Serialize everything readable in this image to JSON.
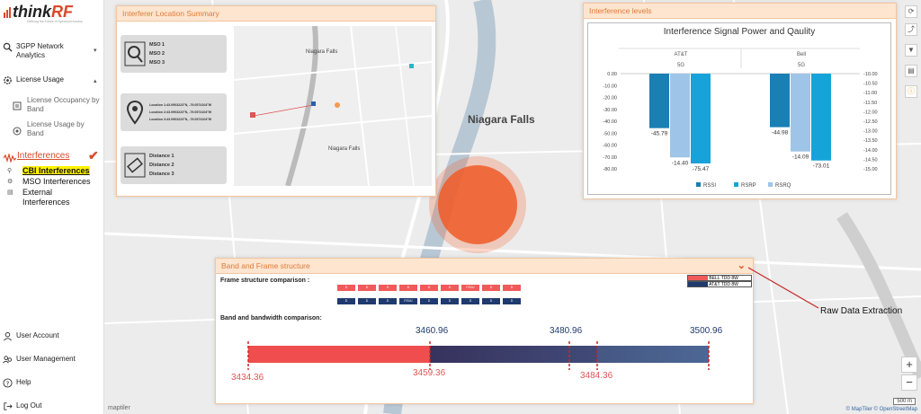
{
  "app": {
    "logo_text": "think",
    "logo_accent": "RF",
    "logo_tagline": "Defining the Future of Spectrum Access"
  },
  "sidebar": {
    "items": [
      {
        "id": "3gpp",
        "label": "3GPP Network Analytics"
      },
      {
        "id": "license",
        "label": "License Usage"
      },
      {
        "id": "interferences",
        "label": "Interferences"
      }
    ],
    "license_sub": [
      "License Occupancy by Band",
      "License Usage by Band"
    ],
    "interference_sub": [
      "CBI Interferences",
      "MSO Interferences",
      "External Interferences"
    ],
    "bottom": [
      "User Account",
      "User Management",
      "Help",
      "Log Out"
    ]
  },
  "map": {
    "labels": [
      "Niagara Falls",
      "Niagara Falls"
    ],
    "attribution": "© MapTiler © OpenStreetMap",
    "scale": "500 m",
    "zoom_in": "+",
    "zoom_out": "−",
    "logo": "maptiler"
  },
  "interferer_panel": {
    "title": "Interferer Location Summary",
    "cards": [
      {
        "icon": "search-icon",
        "lines": [
          "MSO 1",
          "MSO 2",
          "MSO 3"
        ]
      },
      {
        "icon": "location-pin-icon",
        "lines": [
          "Location 1:43.0903223°N, -79.0574104°W",
          "Location 2:43.0903223°N, -79.0574104°W",
          "Location 3:43.0903223°N, -79.0574104°W"
        ]
      },
      {
        "icon": "ruler-icon",
        "lines": [
          "Distance 1",
          "Distance 2",
          "Distance 3"
        ]
      }
    ],
    "map_labels": [
      "Niagara Falls",
      "Niagara Falls"
    ]
  },
  "levels_panel": {
    "title": "Interference levels",
    "chart_title": "Interference Signal Power and Qaulity"
  },
  "chart_data": {
    "type": "bar",
    "title": "Interference Signal Power and Qaulity",
    "groups": [
      {
        "operator": "AT&T",
        "band": "5G"
      },
      {
        "operator": "Bell",
        "band": "5G"
      }
    ],
    "series": [
      {
        "name": "RSSI",
        "values": [
          -45.79,
          -44.98
        ],
        "color": "#1a7fb3"
      },
      {
        "name": "RSRP",
        "values": [
          -75.47,
          -73.01
        ],
        "color": "#17a3d9"
      },
      {
        "name": "RSRQ",
        "values": [
          -14.4,
          -14.09
        ],
        "color": "#9ec5e8"
      }
    ],
    "left_axis": {
      "min": -80,
      "max": 0,
      "ticks": [
        "0.00",
        "-10.00",
        "-20.00",
        "-30.00",
        "-40.00",
        "-50.00",
        "-60.00",
        "-70.00",
        "-80.00"
      ]
    },
    "right_axis": {
      "min": -15,
      "max": -10,
      "ticks": [
        "-10.00",
        "-10.50",
        "-11.00",
        "-11.50",
        "-12.00",
        "-12.50",
        "-13.00",
        "-13.50",
        "-14.00",
        "-14.50",
        "-15.00"
      ]
    },
    "data_labels": [
      {
        "group": 0,
        "series": "RSSI",
        "text": "-45.79"
      },
      {
        "group": 0,
        "series": "RSRQ",
        "text": "-14.40"
      },
      {
        "group": 0,
        "series": "RSRP",
        "text": "-75.47"
      },
      {
        "group": 1,
        "series": "RSSI",
        "text": "-44.98"
      },
      {
        "group": 1,
        "series": "RSRQ",
        "text": "-14.09"
      },
      {
        "group": 1,
        "series": "RSRP",
        "text": "-73.01"
      }
    ],
    "legend": [
      "RSSI",
      "RSRP",
      "RSRQ"
    ],
    "legend_position": "bottom"
  },
  "band_panel": {
    "title": "Band and Frame structure",
    "frame_label": "Frame structure comparison :",
    "bandwidth_label": "Band and bandwidth comparison:",
    "legend": [
      {
        "label": "BELL TDD 8W",
        "color": "#f15a5a"
      },
      {
        "label": "AT&T TDD 8W",
        "color": "#1f3a6e"
      }
    ],
    "bell_frames": [
      "D",
      "D",
      "D",
      "D",
      "D",
      "D",
      "F/D/U",
      "D",
      "D"
    ],
    "att_frames": [
      "D",
      "D",
      "D",
      "F/D/U",
      "D",
      "D",
      "D",
      "D",
      "D"
    ],
    "top_freqs": [
      "3460.96",
      "3480.96",
      "3500.96"
    ],
    "bottom_freqs": [
      "3434.36",
      "3459.36",
      "3484.36"
    ]
  },
  "annotation": "Raw Data Extraction",
  "toolbar_icons": [
    "refresh-icon",
    "export-icon",
    "filter-icon",
    "document-icon",
    "info-icon"
  ]
}
